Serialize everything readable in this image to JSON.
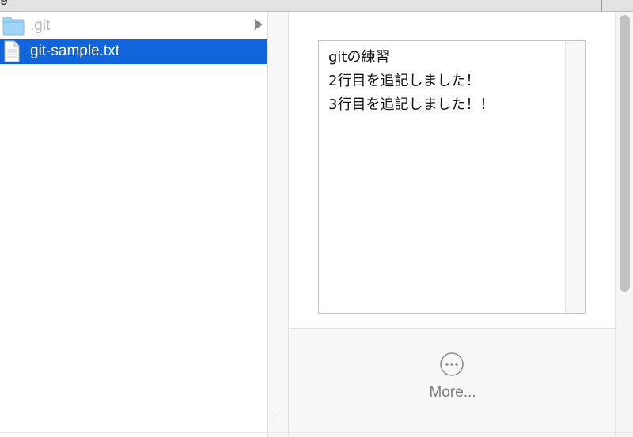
{
  "window": {
    "top_strip_partial_text": "g"
  },
  "browser": {
    "items": [
      {
        "name": ".git",
        "type": "folder",
        "selected": false,
        "has_children": true,
        "icon": "folder-icon"
      },
      {
        "name": "git-sample.txt",
        "type": "file",
        "selected": true,
        "has_children": false,
        "icon": "text-file-icon"
      }
    ]
  },
  "preview": {
    "content_lines": [
      "gitの練習",
      "2行目を追記しました！",
      "3行目を追記しました！！"
    ],
    "more_label": "More..."
  },
  "colors": {
    "selection": "#0f65d9",
    "folder": "#8ccdf2",
    "disabled_text": "#b9b9b9",
    "scrollbar_thumb": "#c2c2c2"
  }
}
